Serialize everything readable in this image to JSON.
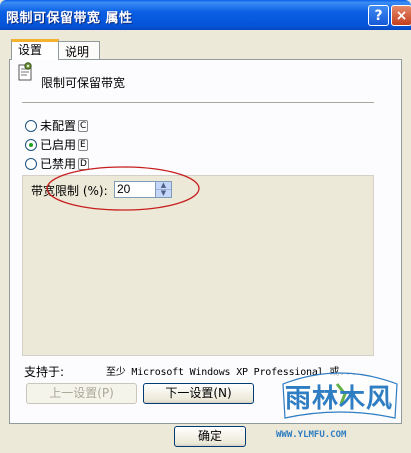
{
  "window": {
    "title": "限制可保留带宽 属性"
  },
  "titlebar": {
    "help_label": "?",
    "close_label": "×"
  },
  "tabs": [
    {
      "label": "设置"
    },
    {
      "label": "说明"
    }
  ],
  "policy": {
    "name": "限制可保留带宽",
    "icon": "policy-icon"
  },
  "state_options": [
    {
      "label": "未配置",
      "key": "C",
      "selected": false
    },
    {
      "label": "已启用",
      "key": "E",
      "selected": true
    },
    {
      "label": "已禁用",
      "key": "D",
      "selected": false
    }
  ],
  "bandwidth": {
    "label": "带宽限制 (%):",
    "value": "20"
  },
  "spinner": {
    "up": "▲",
    "down": "▼"
  },
  "supported": {
    "label": "支持于:",
    "value": "至少 Microsoft Windows XP Professional 或..."
  },
  "buttons": {
    "prev": "上一设置(P)",
    "next": "下一设置(N)",
    "ok": "确定"
  },
  "watermark": {
    "text": "雨林木风",
    "url": "WWW.YLMFU.COM"
  },
  "colors": {
    "titlebar": "#0553d6",
    "annotation": "#c81e1e",
    "dialog_bg": "#ece9d8",
    "tab_accent": "#f6b22d"
  }
}
